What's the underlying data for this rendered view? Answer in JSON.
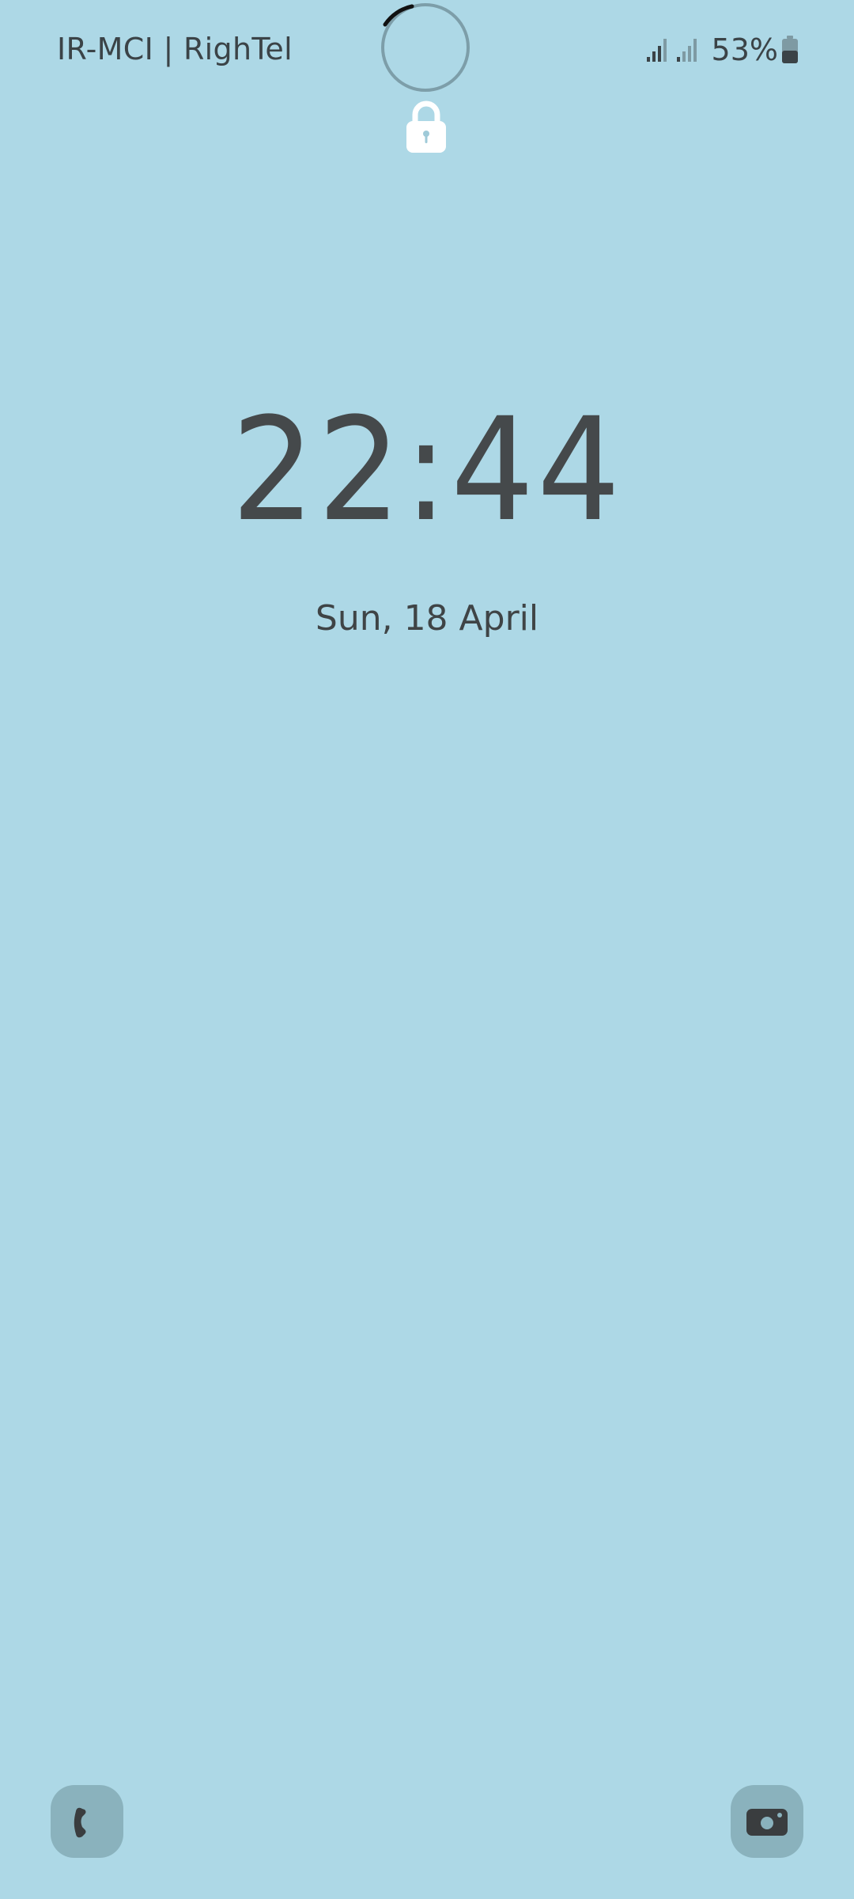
{
  "status_bar": {
    "carrier": "IR-MCI | RighTel",
    "battery_percent": "53%",
    "battery_level": 0.53,
    "icons": [
      "signal-bars-sim1-icon",
      "signal-bars-sim2-icon",
      "battery-icon"
    ]
  },
  "lockscreen": {
    "lock_icon": "lock-icon",
    "time": "22:44",
    "date": "Sun, 18 April"
  },
  "shortcuts": {
    "left": "phone-icon",
    "right": "camera-icon"
  },
  "colors": {
    "background": "#add8e6",
    "text": "#3d3f41",
    "shortcut_bg": "#8ab2bd"
  }
}
